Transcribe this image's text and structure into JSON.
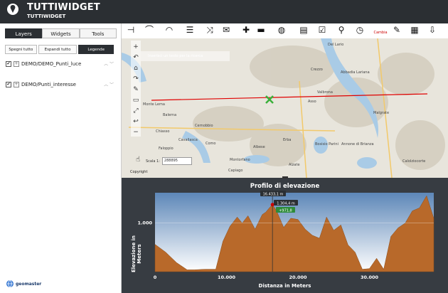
{
  "header": {
    "title": "TUTTIWIDGET",
    "subtitle": "TUTTIWIDGET"
  },
  "tabs": [
    {
      "label": "Layers",
      "active": true
    },
    {
      "label": "Widgets",
      "active": false
    },
    {
      "label": "Tools",
      "active": false
    }
  ],
  "layer_actions": {
    "hide_all": "Spegni tutto",
    "expand_all": "Espandi tutto",
    "legend": "Legende"
  },
  "layers": [
    {
      "name": "DEMO/DEMO_Punti_luce",
      "checked": true
    },
    {
      "name": "DEMO/Punti_interesse",
      "checked": true
    }
  ],
  "footer_logo": "geomaster",
  "toolbar": {
    "change_label": "Cambia"
  },
  "map": {
    "search_placeholder": "Inserisci un testo per la ricerca",
    "scale_label": "Scala 1:",
    "scale_value": "288895",
    "copyright": "Copyright",
    "places": [
      "Del Lario",
      "Crezzo",
      "Abbadia Lariana",
      "Valbrona",
      "Asso",
      "Malgrate",
      "Erba",
      "Bosisio Parini",
      "Annone di Brianza",
      "Cernobbio",
      "Como",
      "Montorfano",
      "Albese",
      "Calolziocorte",
      "Monte Lema",
      "Balerna",
      "Chiasso",
      "Cavallasca",
      "Faloppio",
      "Capiago",
      "Alzate"
    ]
  },
  "profile": {
    "title": "Profilo di elevazione",
    "ylabel": "Elevazione in Meters",
    "xlabel": "Distanza in Meters",
    "tooltip_distance": "16.433,1 m",
    "tooltip_elevation": "1.304,4 m",
    "tooltip_gain": "+971,8",
    "colors": {
      "fill": "#b8692a",
      "sky_top": "#5d87b8",
      "sky_bottom": "#ffffff",
      "track": "#e00000"
    }
  },
  "chart_data": {
    "type": "area",
    "title": "Profilo di elevazione",
    "xlabel": "Distanza in Meters",
    "ylabel": "Elevazione in Meters",
    "x_ticks": [
      "0",
      "10.000",
      "20.000",
      "30.000"
    ],
    "y_ticks": [
      "1.000"
    ],
    "xlim": [
      0,
      39000
    ],
    "ylim": [
      200,
      1500
    ],
    "x": [
      0,
      1500,
      3000,
      4500,
      5500,
      7000,
      8500,
      9500,
      10500,
      11500,
      12200,
      13000,
      14000,
      15000,
      15500,
      16000,
      16433,
      17000,
      18000,
      19000,
      20000,
      21000,
      22000,
      23000,
      24000,
      25000,
      26000,
      27000,
      28000,
      29000,
      30000,
      31000,
      32000,
      33000,
      34000,
      35000,
      36000,
      37000,
      38000,
      39000
    ],
    "y": [
      650,
      520,
      350,
      230,
      230,
      240,
      240,
      700,
      950,
      1100,
      1000,
      1120,
      900,
      1140,
      1180,
      1250,
      1304,
      1200,
      930,
      1080,
      1060,
      900,
      800,
      750,
      1100,
      880,
      970,
      640,
      520,
      240,
      250,
      420,
      240,
      780,
      920,
      1000,
      1200,
      1250,
      1450,
      1080
    ]
  }
}
